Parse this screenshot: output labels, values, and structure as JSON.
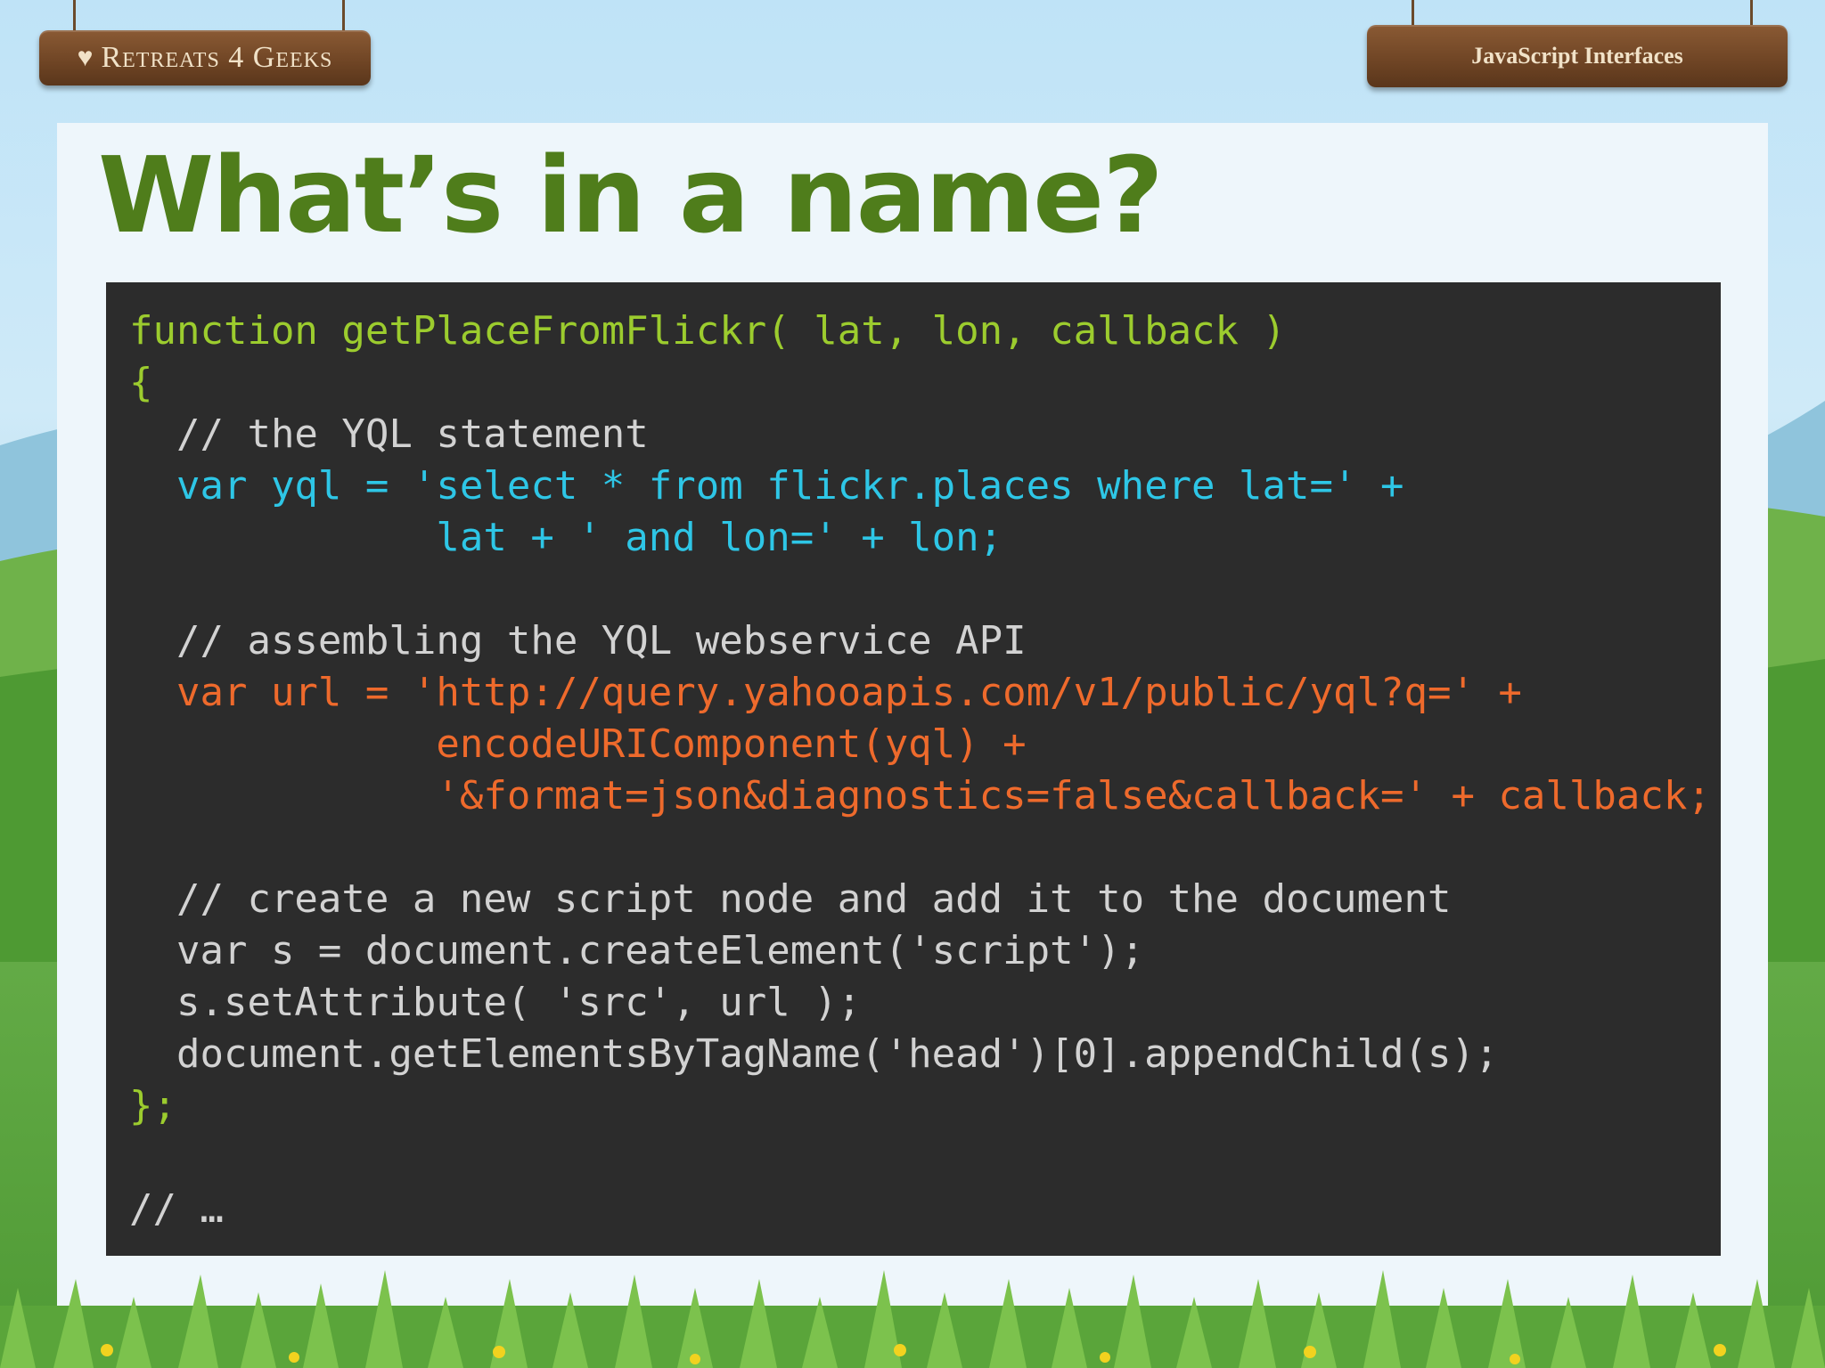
{
  "header": {
    "logo_text": "Retreats 4 Geeks",
    "section_label": "JavaScript Interfaces"
  },
  "slide": {
    "title": "What’s in a name?"
  },
  "code": {
    "lines": [
      "function getPlaceFromFlickr( lat, lon, callback )",
      "{",
      "  // the YQL statement",
      "  var yql = 'select * from flickr.places where lat=' +",
      "             lat + ' and lon=' + lon;",
      "",
      "  // assembling the YQL webservice API",
      "  var url = 'http://query.yahooapis.com/v1/public/yql?q=' +",
      "             encodeURIComponent(yql) +",
      "             '&format=json&diagnostics=false&callback=' + callback;",
      "",
      "  // create a new script node and add it to the document",
      "  var s = document.createElement('script');",
      "  s.setAttribute( 'src', url );",
      "  document.getElementsByTagName('head')[0].appendChild(s);",
      "};",
      "",
      "// …"
    ]
  },
  "colors": {
    "title": "#4f7d1b",
    "code_background": "#2c2c2c",
    "code_function": "#9ccc2e",
    "code_comment": "#d2d2d2",
    "code_yql": "#2ec6e6",
    "code_url": "#ee6a2c"
  },
  "icons": [
    "heart-icon"
  ]
}
